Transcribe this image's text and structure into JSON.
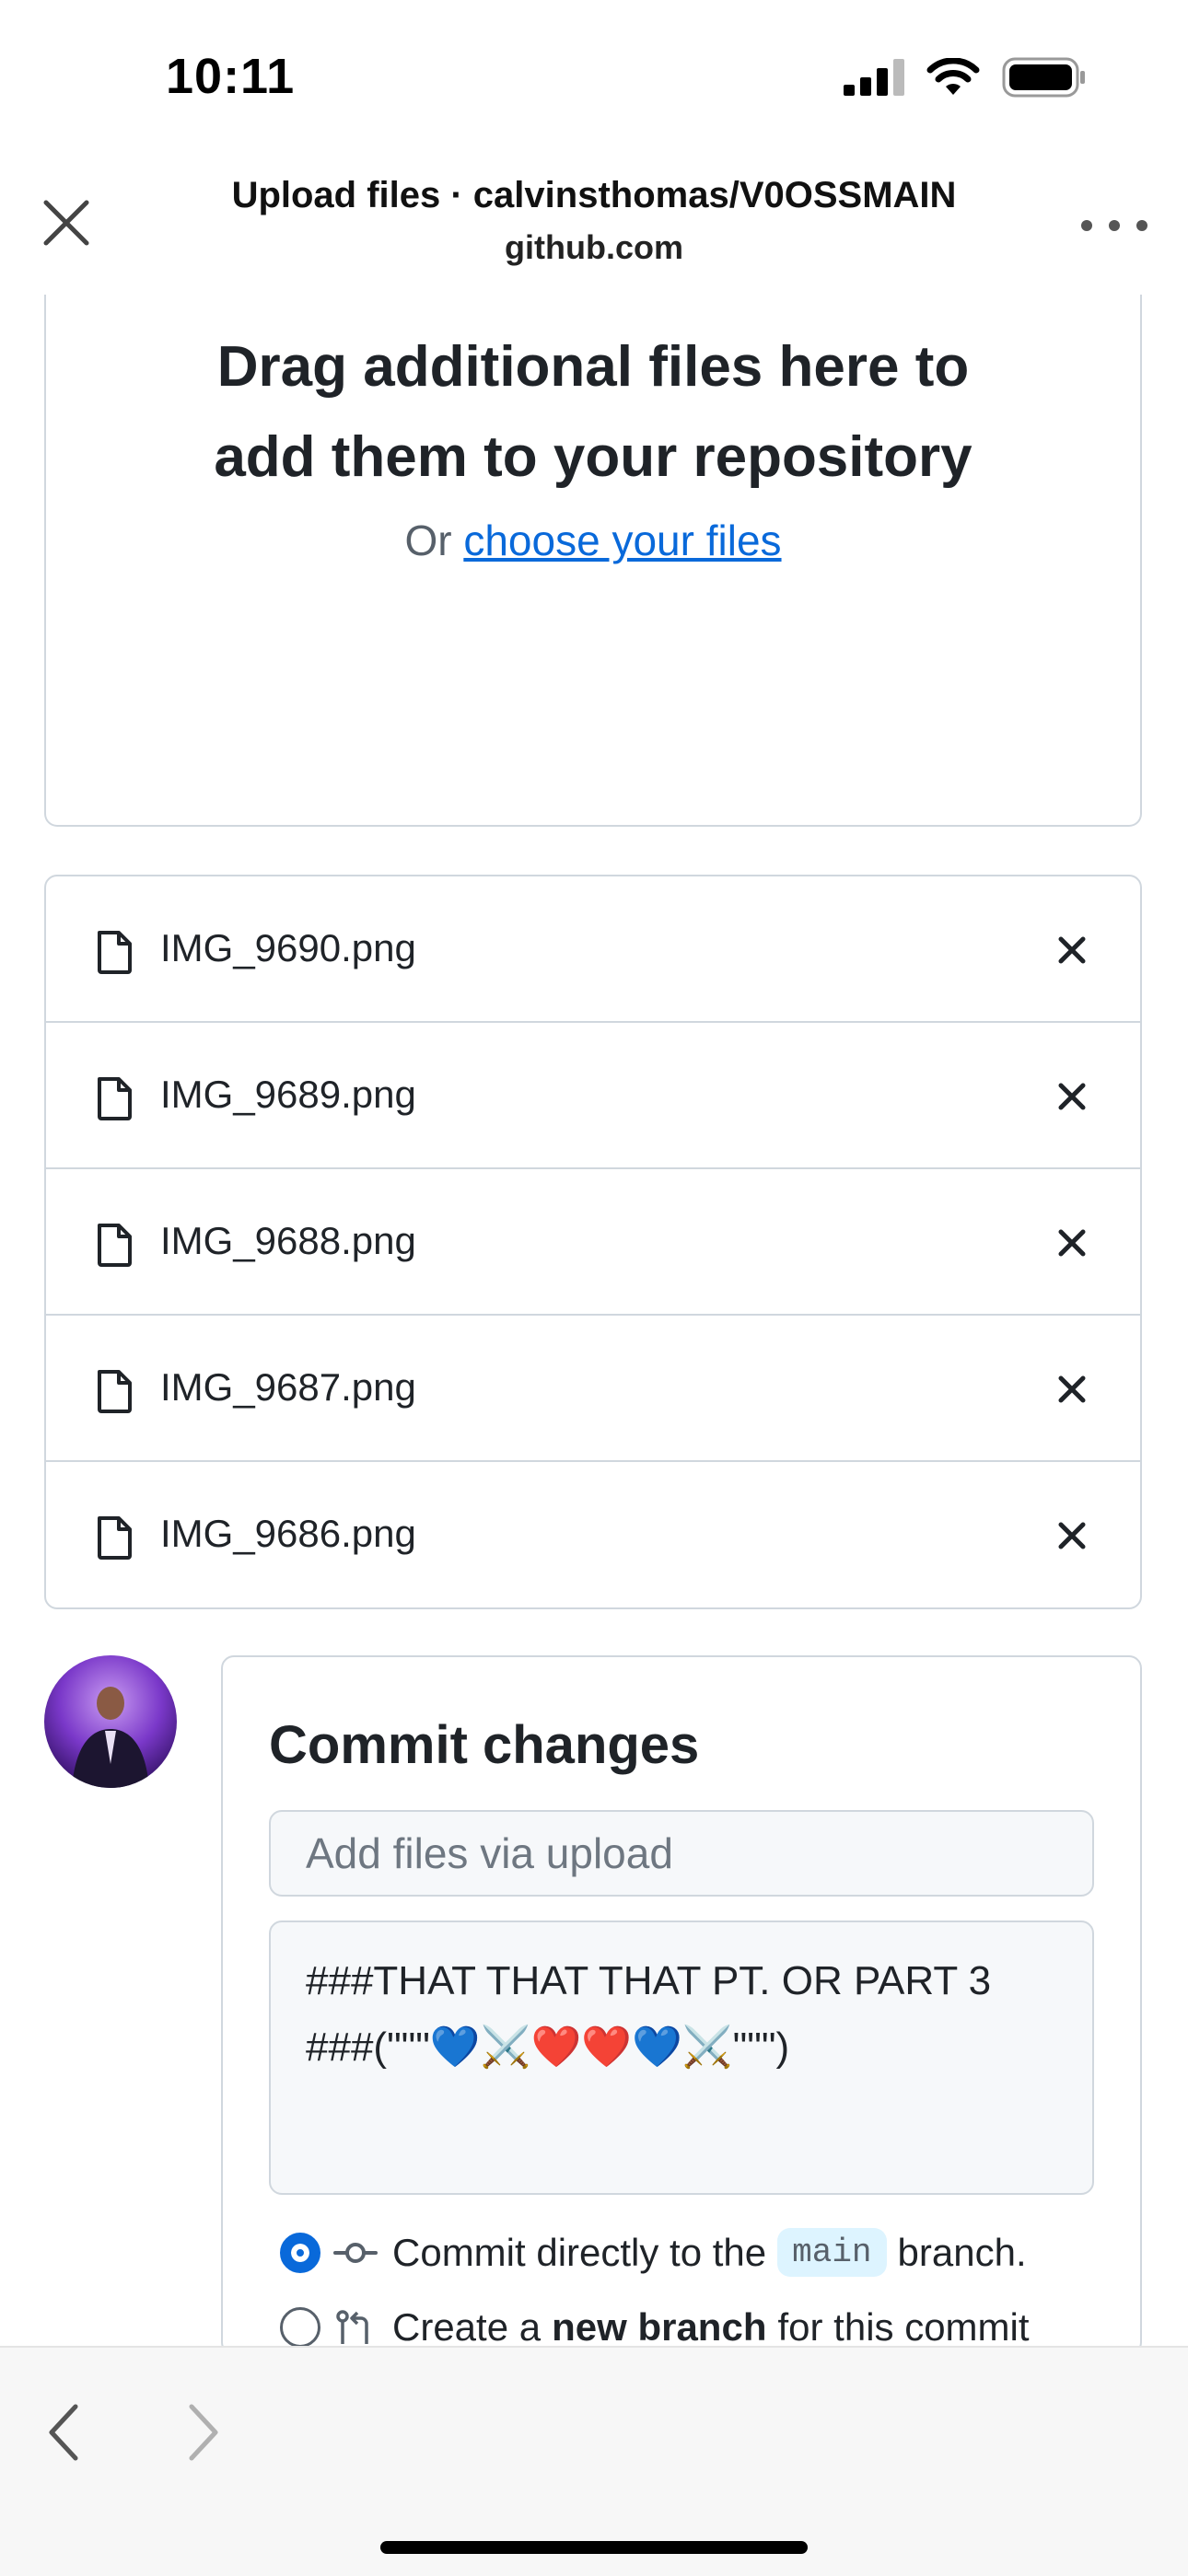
{
  "status_bar": {
    "time": "10:11",
    "icons": [
      "signal-icon",
      "wifi-icon",
      "battery-icon"
    ]
  },
  "browser": {
    "title": "Upload files · calvinsthomas/V0OSSMAIN",
    "domain": "github.com",
    "close_icon": "close-icon",
    "more_icon": "more-icon"
  },
  "drop_zone": {
    "title_line1": "Drag additional files here to",
    "title_line2": "add them to your repository",
    "prefix": "Or",
    "link": "choose your files"
  },
  "files": [
    {
      "name": "IMG_9690.png"
    },
    {
      "name": "IMG_9689.png"
    },
    {
      "name": "IMG_9688.png"
    },
    {
      "name": "IMG_9687.png"
    },
    {
      "name": "IMG_9686.png"
    }
  ],
  "commit": {
    "title": "Commit changes",
    "summary_placeholder": "Add files via upload",
    "summary_value": "",
    "description": "###THAT THAT THAT PT. OR PART 3\n###(\"\"\"💙⚔️❤️❤️💙⚔️\"\"\")",
    "option_direct": {
      "before": "Commit directly to the",
      "branch": "main",
      "after": "branch.",
      "checked": true
    },
    "option_new": {
      "before": "Create a",
      "bold": "new branch",
      "after": "for this commit",
      "checked": false
    }
  },
  "colors": {
    "accent": "#0969da",
    "border": "#d0d7de",
    "text": "#1f2328",
    "muted": "#57606a"
  }
}
